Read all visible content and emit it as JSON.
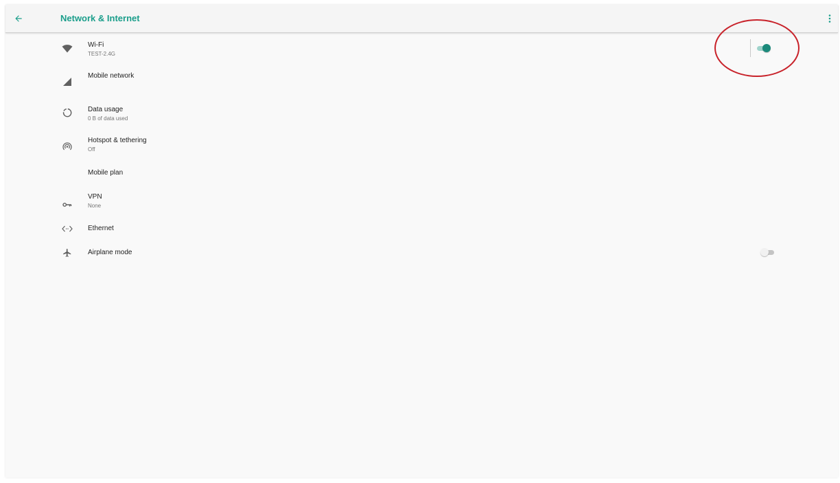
{
  "appbar": {
    "title": "Network & Internet",
    "back_icon": "arrow-back-icon",
    "menu_icon": "more-vert-icon"
  },
  "items": [
    {
      "label": "Wi-Fi",
      "sub": "TEST-2.4G",
      "icon": "wifi-icon",
      "toggle": true
    },
    {
      "label": "Mobile network",
      "icon": "signal-icon"
    },
    {
      "label": "Data usage",
      "sub": "0 B of data used",
      "icon": "data-usage-icon"
    },
    {
      "label": "Hotspot & tethering",
      "sub": "Off",
      "icon": "hotspot-icon"
    },
    {
      "label": "Mobile plan"
    },
    {
      "label": "VPN",
      "sub": "None",
      "icon": "vpn-key-icon"
    },
    {
      "label": "Ethernet",
      "icon": "ethernet-icon"
    },
    {
      "label": "Airplane mode",
      "icon": "airplane-icon",
      "toggle": false
    }
  ],
  "colors": {
    "accent": "#1b9e8b",
    "switch_track_on": "#9fd3cb",
    "switch_thumb_off": "#f1f1f1",
    "switch_track_off": "#c4c4c4",
    "annotation": "#c8222a"
  }
}
